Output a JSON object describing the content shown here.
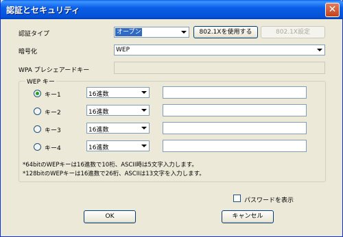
{
  "window": {
    "title": "認証とセキュリティ"
  },
  "auth": {
    "label": "認証タイプ",
    "selected": "オープン",
    "use_8021x_button": "802.1Xを使用する",
    "settings_8021x_button": "802.1X設定"
  },
  "encryption": {
    "label": "暗号化",
    "selected": "WEP"
  },
  "wpa": {
    "label": "WPA プレシェアードキー"
  },
  "wep": {
    "group_title": "WEP キー",
    "keys": [
      {
        "label": "キー1",
        "format": "16進数",
        "selected": true
      },
      {
        "label": "キー2",
        "format": "16進数",
        "selected": false
      },
      {
        "label": "キー3",
        "format": "16進数",
        "selected": false
      },
      {
        "label": "キー4",
        "format": "16進数",
        "selected": false
      }
    ],
    "notes": [
      "*64bitのWEPキーは16進数で10桁、ASCII時は5文字入力します。",
      "*128bitのWEPキーは16進数で26桁、ASCIIは13文字を入力します。"
    ]
  },
  "show_password": {
    "label": "パスワードを表示",
    "checked": false
  },
  "buttons": {
    "ok": "OK",
    "cancel": "キャンセル"
  }
}
